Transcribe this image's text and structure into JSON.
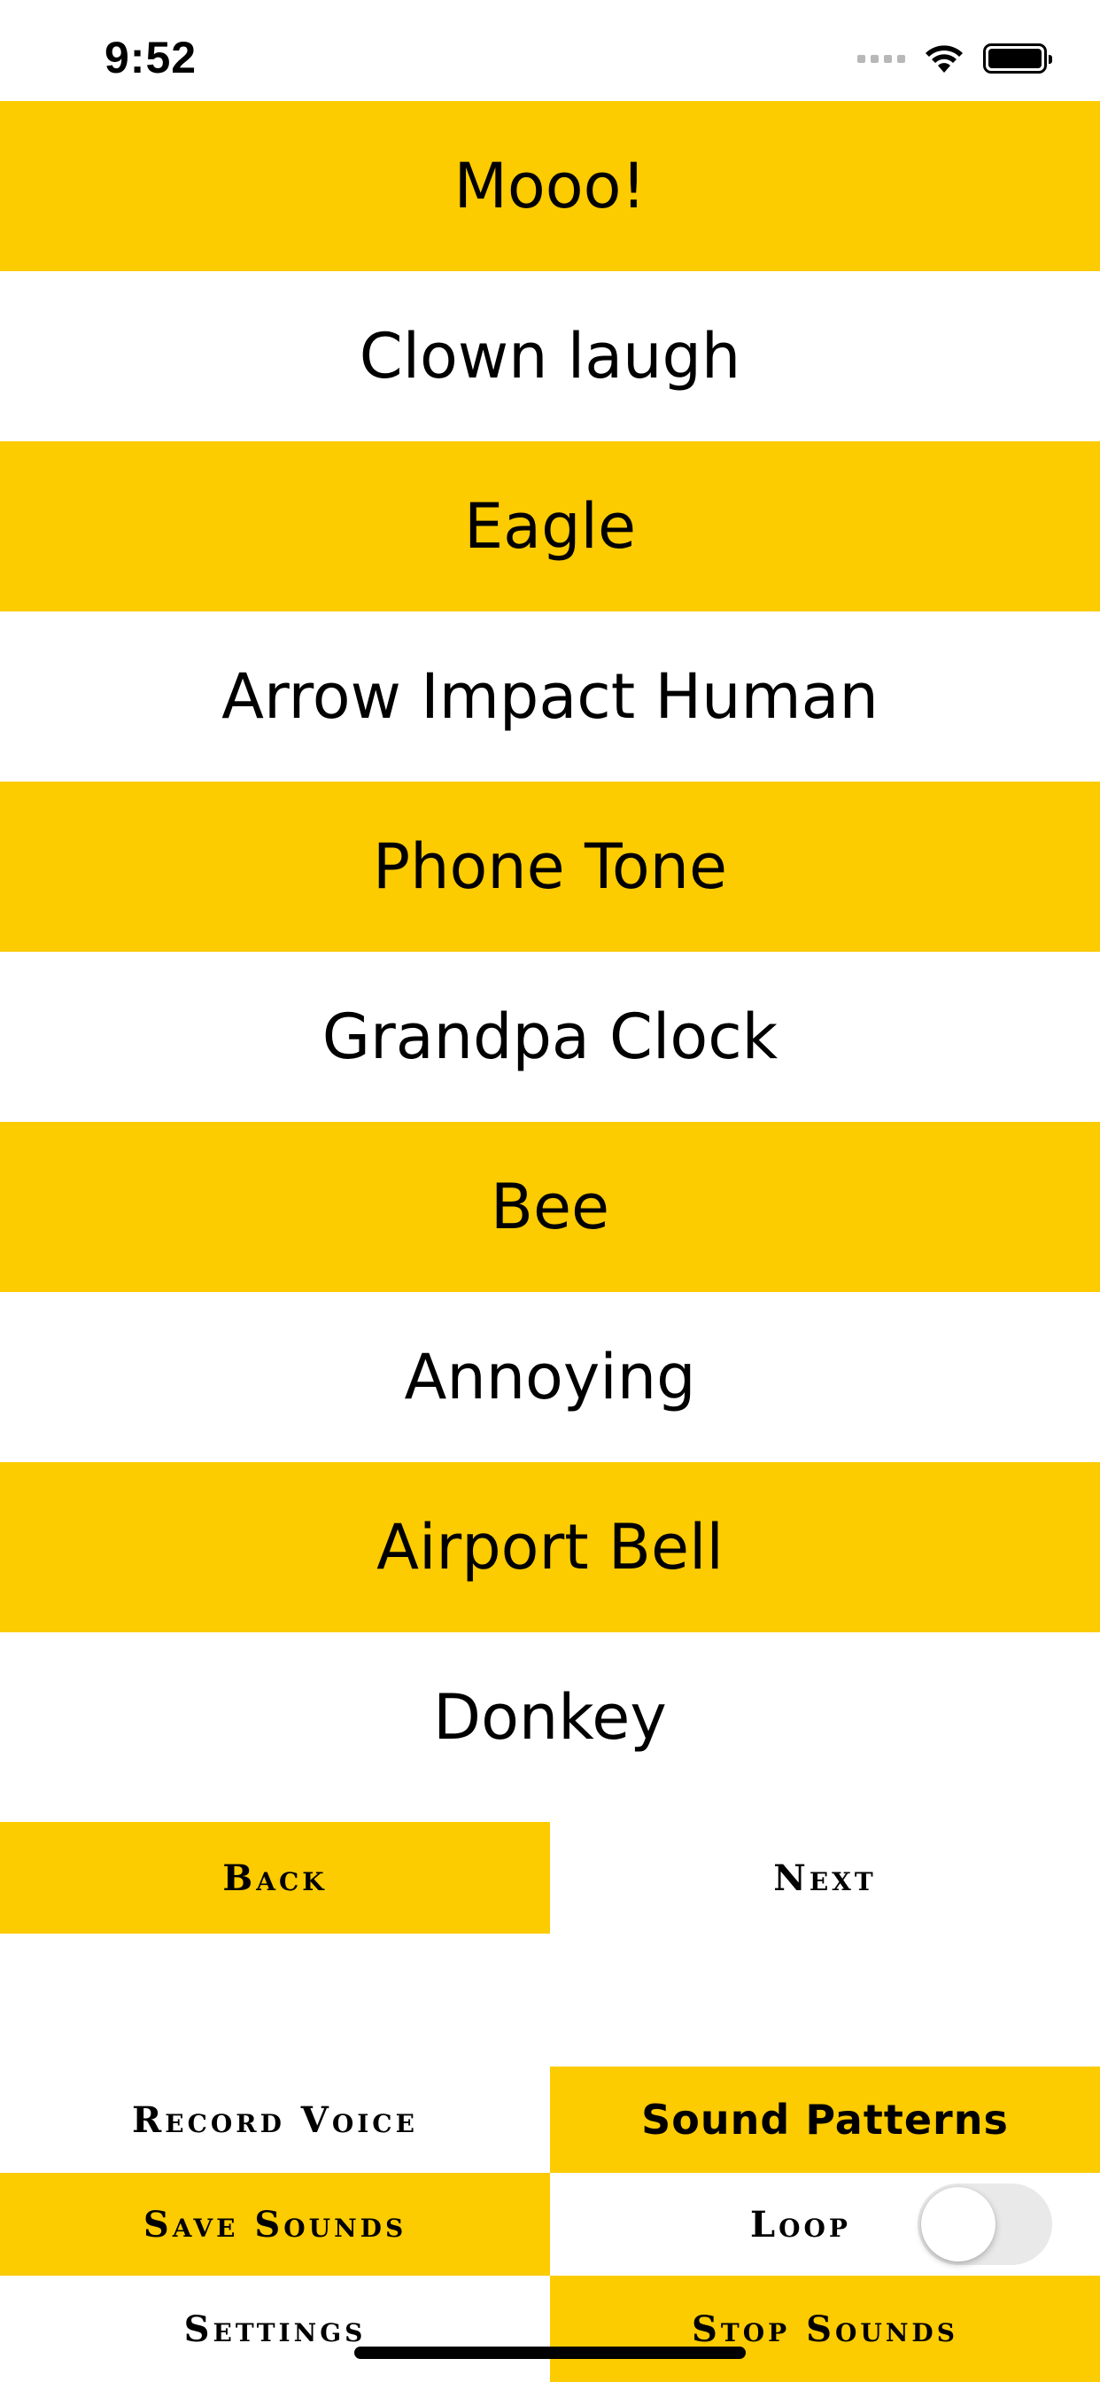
{
  "status_bar": {
    "time": "9:52",
    "icons": [
      "signal-dots-icon",
      "wifi-icon",
      "battery-icon"
    ]
  },
  "colors": {
    "accent": "#fccb00",
    "background": "#ffffff",
    "text": "#000000",
    "toggle_off": "#e9e9ea"
  },
  "sounds": [
    {
      "label": "Mooo!"
    },
    {
      "label": "Clown laugh"
    },
    {
      "label": "Eagle"
    },
    {
      "label": "Arrow Impact Human"
    },
    {
      "label": "Phone Tone"
    },
    {
      "label": "Grandpa Clock"
    },
    {
      "label": "Bee"
    },
    {
      "label": "Annoying"
    },
    {
      "label": "Airport Bell"
    },
    {
      "label": "Donkey"
    }
  ],
  "pager": {
    "back_label": "Back",
    "next_label": "Next"
  },
  "controls": {
    "record_voice": "Record Voice",
    "sound_patterns": "Sound Patterns",
    "save_sounds": "Save Sounds",
    "loop": "Loop",
    "loop_on": false,
    "settings": "Settings",
    "stop_sounds": "Stop Sounds"
  }
}
